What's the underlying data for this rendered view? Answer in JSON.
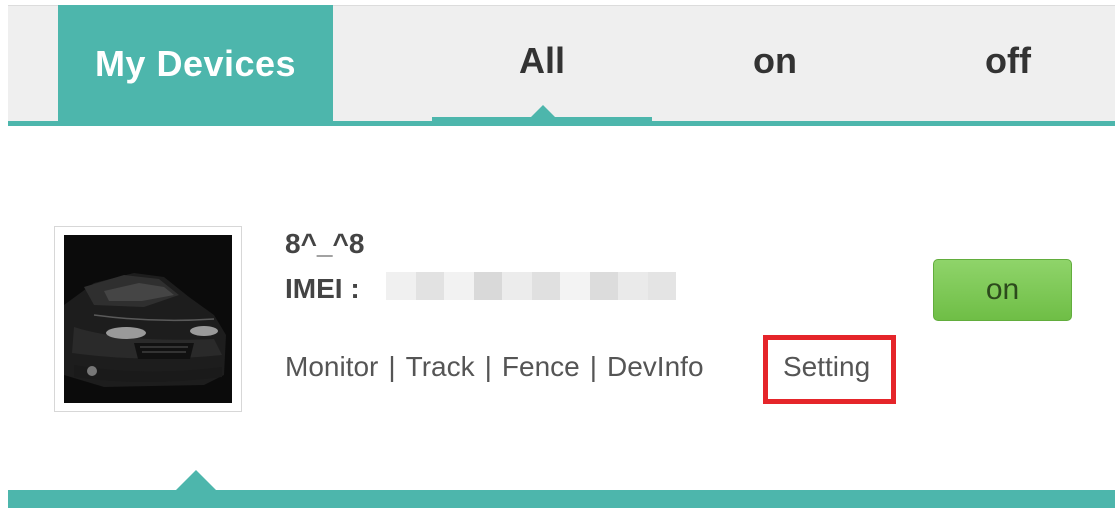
{
  "header": {
    "title": "My Devices",
    "filters": [
      {
        "label": "All",
        "active": true
      },
      {
        "label": "on",
        "active": false
      },
      {
        "label": "off",
        "active": false
      }
    ]
  },
  "device": {
    "name": "8^_^8",
    "imei_label": "IMEI :",
    "imei_value_hidden": true,
    "thumbnail_icon": "car-photo",
    "status_label": "on",
    "actions": [
      "Monitor",
      "Track",
      "Fence",
      "DevInfo",
      "Setting"
    ],
    "separator": "|",
    "highlighted_action": "Setting"
  },
  "colors": {
    "accent": "#4db6ac",
    "status_on": "#7cc654",
    "highlight": "#e5252a"
  }
}
